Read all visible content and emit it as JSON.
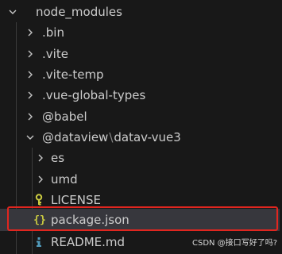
{
  "tree": {
    "root": {
      "label": "node_modules",
      "expanded": true
    },
    "folders": [
      {
        "label": ".bin"
      },
      {
        "label": ".vite"
      },
      {
        "label": ".vite-temp"
      },
      {
        "label": ".vue-global-types"
      },
      {
        "label": "@babel"
      }
    ],
    "scoped": {
      "scope": "@dataview",
      "separator": "\\",
      "package": "datav-vue3",
      "expanded": true,
      "children": [
        {
          "label": "es"
        },
        {
          "label": "umd"
        }
      ],
      "files": [
        {
          "label": "LICENSE",
          "icon": "license-key-icon"
        },
        {
          "label": "package.json",
          "icon": "json-braces-icon",
          "selected": true
        },
        {
          "label": "README.md",
          "icon": "markdown-info-icon"
        }
      ]
    }
  },
  "colors": {
    "background": "#181818",
    "text": "#cccccc",
    "selection": "#37373d",
    "annotation_box": "#e0261f",
    "json_icon": "#cbcb41",
    "license_icon": "#cbcb41",
    "markdown_icon": "#519aba"
  },
  "watermark": "CSDN @接口写好了吗?"
}
